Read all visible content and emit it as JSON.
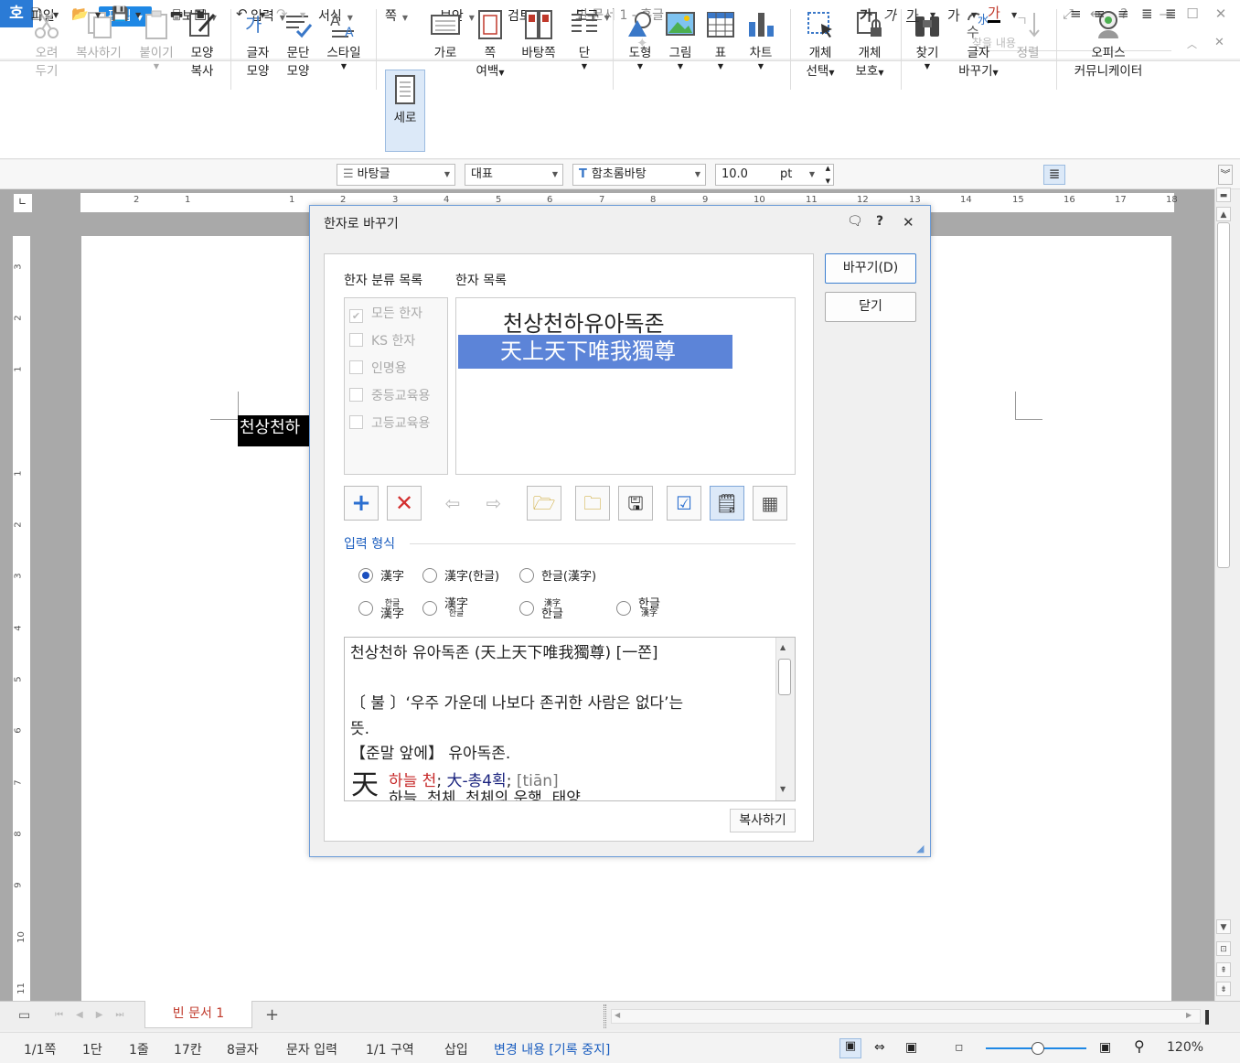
{
  "window": {
    "title": "빈 문서 1 - 훈글",
    "logo": "호"
  },
  "menu": {
    "file": "파일",
    "items": [
      "편집",
      "보기",
      "입력",
      "서식",
      "쪽",
      "보안",
      "검토",
      "도구"
    ],
    "search_placeholder": "찾을 내용"
  },
  "ribbon": {
    "cut": [
      "오려",
      "두기"
    ],
    "copy": "복사하기",
    "paste": "붙이기",
    "format_copy": [
      "모양",
      "복사"
    ],
    "char_shape": [
      "글자",
      "모양"
    ],
    "para_shape": [
      "문단",
      "모양"
    ],
    "style": "스타일",
    "portrait": "세로",
    "landscape": "가로",
    "page_margin": [
      "쪽",
      "여백"
    ],
    "background": "바탕쪽",
    "columns": "단",
    "shape": "도형",
    "picture": "그림",
    "table": "표",
    "chart": "차트",
    "obj_select": [
      "개체",
      "선택"
    ],
    "obj_protect": [
      "개체",
      "보호"
    ],
    "find": "찾기",
    "char_replace": [
      "글자",
      "바꾸기"
    ],
    "sort": "정렬",
    "office": [
      "오피스",
      "커뮤니케이터"
    ]
  },
  "format": {
    "style": "바탕글",
    "lang": "대표",
    "font": "함초롬바탕",
    "size": "10.0",
    "unit": "pt",
    "bold": "가",
    "italic": "가",
    "underline": "가",
    "strike": "가",
    "color": "가"
  },
  "ruler": {
    "h_ticks": [
      "2",
      "1",
      "1",
      "2",
      "3",
      "4",
      "5",
      "6",
      "7",
      "8",
      "9",
      "10",
      "11",
      "12",
      "13",
      "14",
      "15",
      "16",
      "17",
      "18"
    ],
    "v_ticks": [
      "3",
      "2",
      "1",
      "1",
      "2",
      "3",
      "4",
      "5",
      "6",
      "7",
      "8",
      "9",
      "10",
      "11"
    ]
  },
  "document": {
    "selected_text": "천상천하"
  },
  "tabs": {
    "doc": "빈 문서 1",
    "add": "+"
  },
  "status": {
    "page": "1/1쪽",
    "column": "1단",
    "line": "1줄",
    "col": "17칸",
    "chars": "8글자",
    "mode": "문자 입력",
    "section": "1/1 구역",
    "insert": "삽입",
    "track": "변경 내용 [기록 중지]",
    "zoom": "120%"
  },
  "dialog": {
    "title": "한자로 바꾸기",
    "replace_btn": "바꾸기(D)",
    "close_btn": "닫기",
    "cat_label": "한자 분류 목록",
    "list_label": "한자 목록",
    "categories": [
      "모든 한자",
      "KS 한자",
      "인명용",
      "중등교육용",
      "고등교육용"
    ],
    "hanja_items": [
      "천상천하유아독존",
      "天上天下唯我獨尊"
    ],
    "section_label": "입력 형식",
    "formats": {
      "f1": "漢字",
      "f2": "漢字(한글)",
      "f3": "한글(漢字)",
      "f4_top": "한글",
      "f4_bottom": "漢字",
      "f5_top": "漢字",
      "f5_bottom": "한글",
      "f6_top": "漢字",
      "f6_bottom": "한글",
      "f7_top": "한글",
      "f7_bottom": "漢字"
    },
    "dict": {
      "line1": "천상천하 유아독존 (天上天下唯我獨尊) [一쫀]",
      "line2": "〔 불 〕‘우주 가운데 나보다 존귀한 사람은 없다’는",
      "line3": "뜻.",
      "line4": "【준말 앞에】 유아독존.",
      "big_char": "天",
      "meaning": "하늘 천",
      "radical": "大-총4획",
      "pinyin": "[tiān]",
      "line6": "하늘, 천체, 천체의 운행, 태양"
    },
    "copy_btn": "복사하기"
  }
}
